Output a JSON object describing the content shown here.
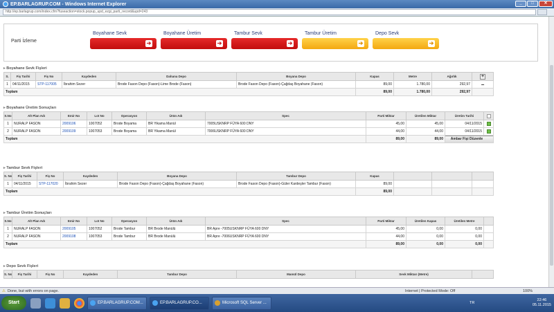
{
  "window": {
    "title": "EP.BARLAGRUP.COM - Windows Internet Explorer",
    "url": "http://ep.barlagrup.com/index.cfm?fuseaction=stock.popup_upd_ezgi_parti_record&upd=243"
  },
  "header": {
    "partiLabel": "Parti İzleme",
    "steps": [
      {
        "label": "Boyahane Sevk",
        "color": "red"
      },
      {
        "label": "Boyahane Üretim",
        "color": "red"
      },
      {
        "label": "Tambur Sevk",
        "color": "red"
      },
      {
        "label": "Tambur Üretim",
        "color": "yellow"
      },
      {
        "label": "Depo Sevk",
        "color": "yellow"
      }
    ]
  },
  "sections": {
    "s1": {
      "title": "Boyahane Sevk Fişleri",
      "columns": [
        "S.",
        "Fiş Tarihi",
        "Fiş No",
        "Kaydeden",
        "Dahana Depo",
        "Boyana Depo",
        "Kapas",
        "Metre",
        "Ağırlık"
      ],
      "rows": [
        [
          "1",
          "04/11/2015",
          "STP-117005",
          "İbrahim Sezer",
          "Brode Fason Depo (Fason)-Lime Brode (Fason)",
          "Brode Fason Depo (Fason)-Çağdaş Boyahane (Fason)",
          "89,00",
          "1.780,00",
          "292,97"
        ]
      ],
      "total": {
        "label": "Toplam",
        "values": [
          "89,00",
          "1.780,00",
          "292,97"
        ]
      }
    },
    "s2": {
      "title": "Boyahane Üretim Sonuçları",
      "columns": [
        "S.No",
        "Alt Plan Adı",
        "Emir No",
        "Lot No",
        "Operasyon",
        "Ürün Adı",
        "Spec",
        "Parti Miktar",
        "Üretilen Miktar",
        "Üretim Tarihi"
      ],
      "rows": [
        [
          "1",
          "NURALP FASON",
          "2009106",
          "1007052",
          "Brode Boyama",
          "BR Yikama Manül",
          "7005USKNRP FÜYA 600 DNY",
          "45,00",
          "45,00",
          "04/11/2015"
        ],
        [
          "2",
          "NURALP FASON",
          "2009109",
          "1007053",
          "Brode Boyama",
          "BR Yikama Manül",
          "7006USKNRP FÜYA 600 DNY",
          "44,00",
          "44,00",
          "04/11/2015"
        ]
      ],
      "total": {
        "label": "Toplam",
        "values": [
          "89,00",
          "89,00"
        ]
      },
      "button": "Ambar Fişi Düzenle"
    },
    "s3": {
      "title": "Tambur Sevk Fişleri",
      "columns": [
        "S. No",
        "Fiş Tarihi",
        "Fiş No",
        "Kaydeden",
        "Boyana Depo",
        "Tambur Depo",
        "Kapas"
      ],
      "rows": [
        [
          "1",
          "04/11/2015",
          "STP-117020",
          "İbrahim Sezer",
          "Brode Fason Depo (Fason)-Çağdaş Boyahane (Fason)",
          "Brode Fason Depo (Fason)-Güler Kardeşler Tambur (Fason)",
          "89,00"
        ]
      ],
      "total": {
        "label": "Toplam",
        "values": [
          "89,00"
        ]
      }
    },
    "s4": {
      "title": "Tambur Üretim Sonuçları",
      "columns": [
        "S.No",
        "Alt Plan Adı",
        "Emir No",
        "Lot No",
        "Operasyon",
        "Ürün Adı",
        "Spec",
        "Parti Miktar",
        "Üretilen Kapas",
        "Üretilen Metre"
      ],
      "rows": [
        [
          "1",
          "NURALP FASON",
          "2009105",
          "1007052",
          "Brode Tambur",
          "BR Brode Manülü",
          "BR Apre -7005USKNRP FÜYA 600 DNY",
          "45,00",
          "0,00",
          "0,00"
        ],
        [
          "2",
          "NURALP FASON",
          "2009108",
          "1007053",
          "Brode Tambur",
          "BR Brode Manülü",
          "BR Apre -7006USKNRP FÜYA 600 DNY",
          "44,00",
          "0,00",
          "0,00"
        ]
      ],
      "total": {
        "label": "Toplam",
        "values": [
          "89,00",
          "0,00",
          "0,00"
        ]
      }
    },
    "s5": {
      "title": "Depo Sevk Fişleri",
      "columns": [
        "S. No",
        "Fiş Tarihi",
        "Fiş No",
        "Kaydeden",
        "Tambur Depo",
        "Mamül Depo",
        "Sevk Miktarı (Metre)"
      ]
    }
  },
  "status": {
    "text": "Done, but with errors on page.",
    "zone": "Internet | Protected Mode: Off",
    "zoom": "100%"
  },
  "taskbar": {
    "start": "Start",
    "tasks": [
      "EP.BARLAGRUP.COM...",
      "EP.BARLAGRUP.CO...",
      "Microsoft SQL Server ..."
    ],
    "lang": "TR",
    "time": "22:46",
    "date": "05.11.2015"
  }
}
